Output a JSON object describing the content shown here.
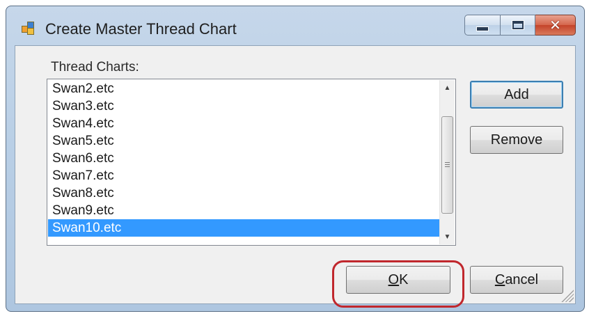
{
  "window": {
    "title": "Create Master Thread Chart",
    "icon": "app-window-icon",
    "controls": {
      "minimize_icon": "minimize-icon",
      "maximize_icon": "maximize-icon",
      "close_icon": "close-icon",
      "close_glyph": "✕"
    }
  },
  "thread_charts": {
    "label": "Thread Charts:",
    "items": [
      "Swan2.etc",
      "Swan3.etc",
      "Swan4.etc",
      "Swan5.etc",
      "Swan6.etc",
      "Swan7.etc",
      "Swan8.etc",
      "Swan9.etc",
      "Swan10.etc"
    ],
    "selected_index": 8,
    "scrollbar": {
      "up_arrow": "▲",
      "down_arrow": "▼"
    }
  },
  "buttons": {
    "add": "Add",
    "remove": "Remove",
    "ok": "OK",
    "cancel": "Cancel"
  },
  "colors": {
    "selection": "#3399ff",
    "highlight_ring": "#c0272d",
    "close_button": "#c4432a"
  }
}
